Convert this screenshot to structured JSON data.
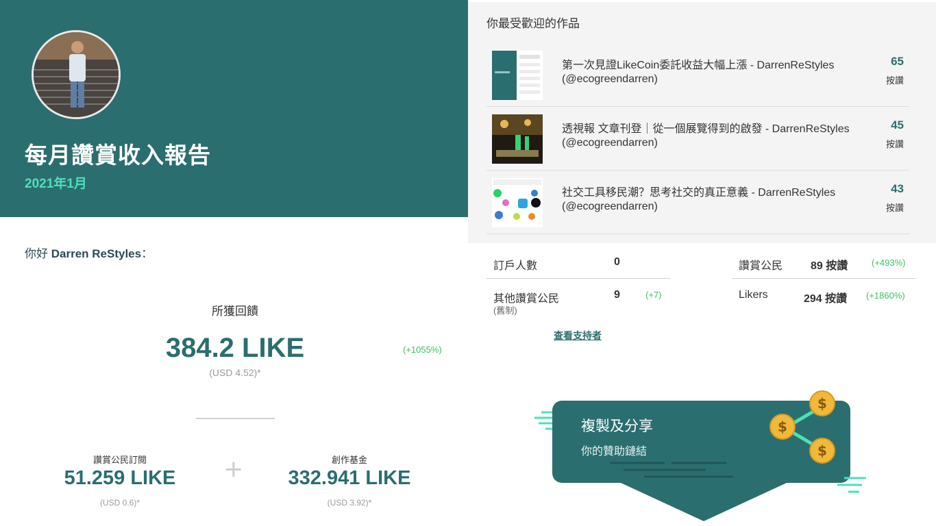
{
  "report": {
    "title": "每月讚賞收入報告",
    "month": "2021年1月",
    "greeting_prefix": "你好",
    "user_name": "Darren ReStyles",
    "greeting_suffix": "："
  },
  "earnings": {
    "label": "所獲回饋",
    "total": "384.2 LIKE",
    "total_usd": "(USD 4.52)*",
    "total_change": "(+1055%)",
    "plus_sign": "+",
    "subscriptions": {
      "label": "讚賞公民訂閱",
      "value": "51.259 LIKE",
      "usd": "(USD 0.6)*"
    },
    "creators_fund": {
      "label": "創作基金",
      "value": "332.941 LIKE",
      "usd": "(USD 3.92)*"
    }
  },
  "popular_works": {
    "title": "你最受歡迎的作品",
    "items": [
      {
        "title": "第一次見證LikeCoin委託收益大幅上漲 - DarrenReStyles",
        "author": "(@ecogreendarren)",
        "count": "65",
        "unit": "按讚"
      },
      {
        "title": "透視報 文章刊登｜從一個展覽得到的啟發 - DarrenReStyles",
        "author": "(@ecogreendarren)",
        "count": "45",
        "unit": "按讚"
      },
      {
        "title": "社交工具移民潮？思考社交的真正意義 - DarrenReStyles",
        "author": "(@ecogreendarren)",
        "count": "43",
        "unit": "按讚"
      }
    ]
  },
  "stats": {
    "subscribers": {
      "label": "訂戶人數",
      "value": "0"
    },
    "other_civic": {
      "label": "其他讚賞公民",
      "note": "(舊制)",
      "value": "9",
      "change": "(+7)"
    },
    "civic_likers": {
      "label": "讚賞公民",
      "value": "89 按讚",
      "change": "(+493%)"
    },
    "likers": {
      "label": "Likers",
      "value": "294 按讚",
      "change": "(+1860%)"
    },
    "view_supporters": "查看支持者"
  },
  "share": {
    "title": "複製及分享",
    "subtitle": "你的贊助鏈結",
    "coin_symbol": "$"
  }
}
